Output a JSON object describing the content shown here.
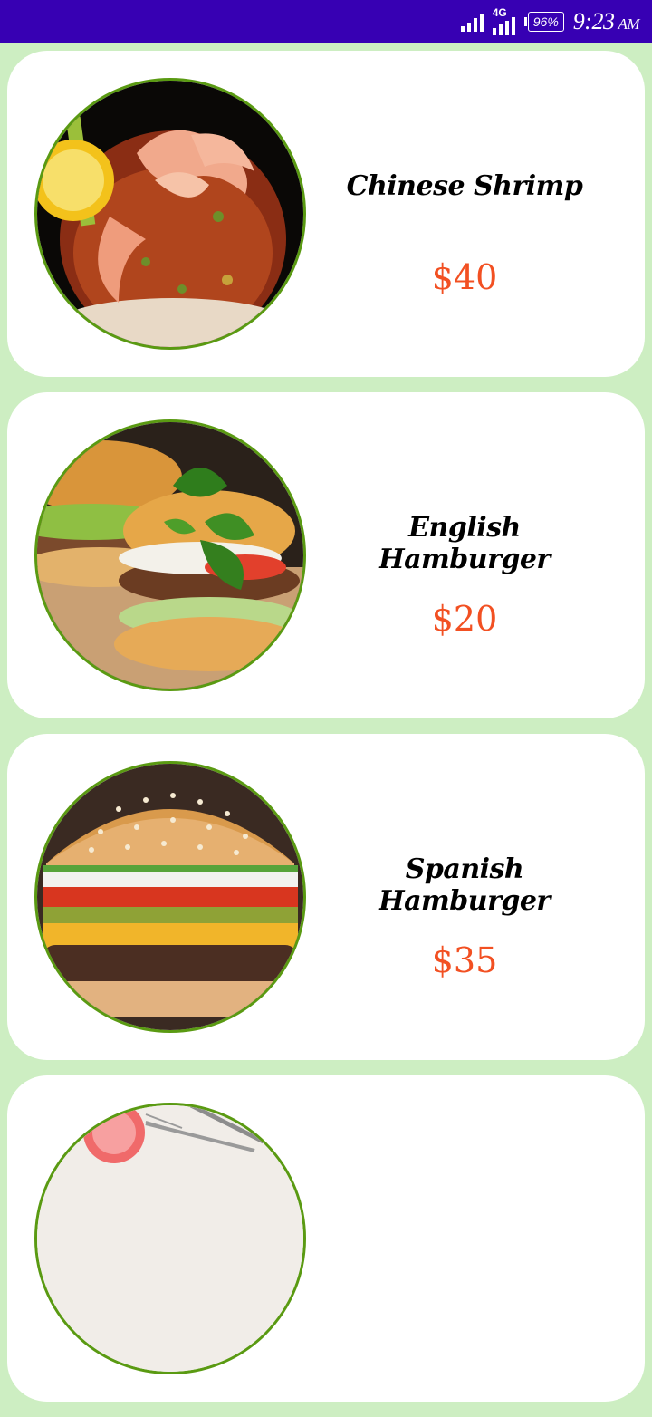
{
  "status_bar": {
    "network": "4G",
    "battery": "96%",
    "time": "9:23",
    "ampm": "AM",
    "color": "#3700b3"
  },
  "colors": {
    "background": "#cdeec2",
    "card": "#ffffff",
    "image_border": "#5a9a12",
    "price": "#f25022"
  },
  "menu": [
    {
      "name": "Chinese Shrimp",
      "price": "$40",
      "image": "shrimp-cocktail-image"
    },
    {
      "name": "English Hamburger",
      "price": "$20",
      "image": "basil-burger-image"
    },
    {
      "name": "Spanish Hamburger",
      "price": "$35",
      "image": "cheeseburger-image"
    },
    {
      "name": "",
      "price": "",
      "image": "grapefruit-plate-image"
    }
  ]
}
